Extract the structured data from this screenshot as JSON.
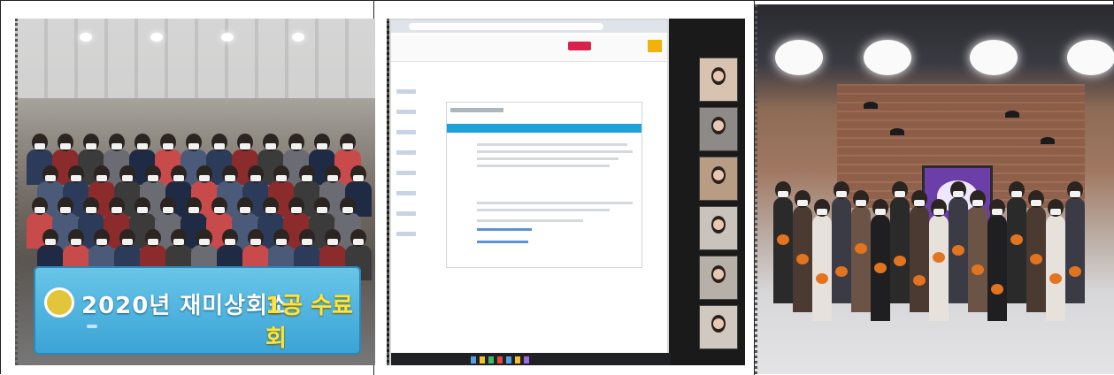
{
  "photo_1": {
    "banner_subtitle": "",
    "banner_title_main": "2020년 재미상회소",
    "banner_title_accent": "1공 수료회",
    "banner_footer": ""
  },
  "photo_2": {},
  "photo_3": {},
  "colors": {
    "banner_blue": "#3aa3d6",
    "accent_yellow": "#ffe43a",
    "doc_header_blue": "#1da1d9",
    "stop_button_red": "#d9214b",
    "screen_purple": "#6b3ea8",
    "pumpkin_orange": "#e3741f"
  }
}
